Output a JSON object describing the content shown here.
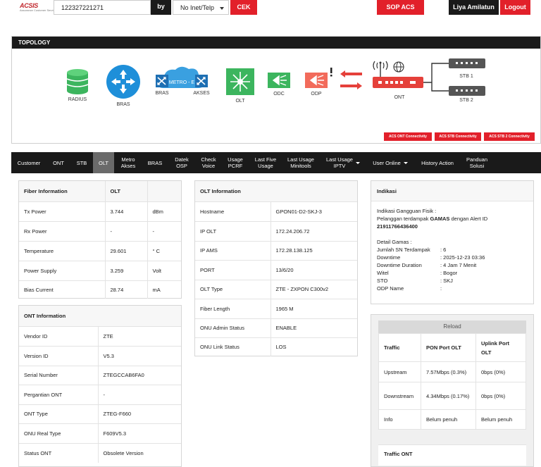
{
  "header": {
    "logo": "ACSIS",
    "logo_sub": "Assurance Customer Service",
    "search_value": "122327221271",
    "by_label": "by",
    "by_select": "No Inet/Telp",
    "cek_label": "CEK",
    "sop_label": "SOP ACS",
    "user_name": "Liya Amilatun",
    "logout_label": "Logout"
  },
  "topology": {
    "title": "TOPOLOGY",
    "nodes": {
      "radius": "RADIUS",
      "bras": "BRAS",
      "metro": "METRO - E",
      "bras2": "BRAS",
      "akses": "AKSES",
      "olt": "OLT",
      "odc": "ODC",
      "odp": "ODP",
      "ont": "ONT",
      "stb1": "STB 1",
      "stb2": "STB 2"
    },
    "buttons": [
      "ACS ONT Connectivity",
      "ACS STB Connectivity",
      "ACS STB 2 Connectivity"
    ],
    "colors": {
      "accent": "#e2202a",
      "radius": "#3cb55e",
      "bras": "#1e8fd9",
      "olt": "#3cb55e",
      "odp": "#f26b5b",
      "ont": "#e5403a"
    }
  },
  "nav": {
    "items": [
      {
        "label": "Customer"
      },
      {
        "label": "ONT"
      },
      {
        "label": "STB"
      },
      {
        "label": "OLT"
      },
      {
        "label": "Metro Akses"
      },
      {
        "label": "BRAS"
      },
      {
        "label": "Datek OSP"
      },
      {
        "label": "Check Voice"
      },
      {
        "label": "Usage PCRF"
      },
      {
        "label": "Last Five Usage"
      },
      {
        "label": "Last Usage Minitools"
      },
      {
        "label": "Last Usage IPTV"
      },
      {
        "label": "User Online"
      },
      {
        "label": "History Action"
      },
      {
        "label": "Panduan Solusi"
      }
    ]
  },
  "fiber": {
    "head": [
      "Fiber Information",
      "OLT",
      ""
    ],
    "rows": [
      {
        "label": "Tx Power",
        "value": "3.744",
        "unit": "dBm"
      },
      {
        "label": "Rx Power",
        "value": "-",
        "unit": "-"
      },
      {
        "label": "Temperature",
        "value": "29.601",
        "unit": "° C"
      },
      {
        "label": "Power Supply",
        "value": "3.259",
        "unit": "Volt"
      },
      {
        "label": "Bias Current",
        "value": "28.74",
        "unit": "mA"
      }
    ]
  },
  "ont_info": {
    "head": "ONT Information",
    "rows": [
      {
        "label": "Vendor ID",
        "value": "ZTE"
      },
      {
        "label": "Version ID",
        "value": "V5.3"
      },
      {
        "label": "Serial Number",
        "value": "ZTEGCCAB6FA0"
      },
      {
        "label": "Pergantian ONT",
        "value": "-"
      },
      {
        "label": "ONT Type",
        "value": "ZTEG-F660"
      },
      {
        "label": "ONU Real Type",
        "value": "F609V5.3"
      },
      {
        "label": "Status ONT",
        "value": "Obsolete Version"
      }
    ]
  },
  "olt_info": {
    "head": "OLT Information",
    "rows": [
      {
        "label": "Hostname",
        "value": "GPON01-D2-SKJ-3"
      },
      {
        "label": "IP OLT",
        "value": "172.24.206.72"
      },
      {
        "label": "IP AMS",
        "value": "172.28.138.125"
      },
      {
        "label": "PORT",
        "value": "13/6/20"
      },
      {
        "label": "OLT Type",
        "value": "ZTE - ZXPON C300v2"
      },
      {
        "label": "Fiber Length",
        "value": "1965 M"
      },
      {
        "label": "ONU Admin Status",
        "value": "ENABLE"
      },
      {
        "label": "ONU Link Status",
        "value": "LOS"
      }
    ]
  },
  "indikasi": {
    "head": "Indikasi",
    "gangguan_title": "Indikasi Gangguan Fisik :",
    "gangguan_text_pre": "Pelanggan terdampak",
    "gangguan_text_b": "GAMAS",
    "gangguan_text_post": "dengan Alert ID",
    "alert_id": "21911766436400",
    "detail_title": "Detail Gamas :",
    "details": [
      {
        "k": "Jumlah SN Terdampak",
        "v": ": 6"
      },
      {
        "k": "Downtime",
        "v": ": 2025-12-23 03:36"
      },
      {
        "k": "Downtime Duration",
        "v": ": 4 Jam 7 Menit"
      },
      {
        "k": "Witel",
        "v": ": Bogor"
      },
      {
        "k": "STO",
        "v": ": SKJ"
      },
      {
        "k": "ODP Name",
        "v": ":"
      }
    ]
  },
  "traffic": {
    "reload_label": "Reload",
    "head": [
      "Traffic",
      "PON Port OLT",
      "Uplink Port OLT"
    ],
    "rows": [
      {
        "label": "Upstream",
        "pon": "7.57Mbps (0.3%)",
        "uplink": "0bps (0%)"
      },
      {
        "label": "Downstream",
        "pon": "4.34Mbps (0.17%)",
        "uplink": "0bps (0%)"
      },
      {
        "label": "Info",
        "pon": "Belum penuh",
        "uplink": "Belum penuh"
      }
    ],
    "traffic_ont": "Traffic ONT"
  }
}
